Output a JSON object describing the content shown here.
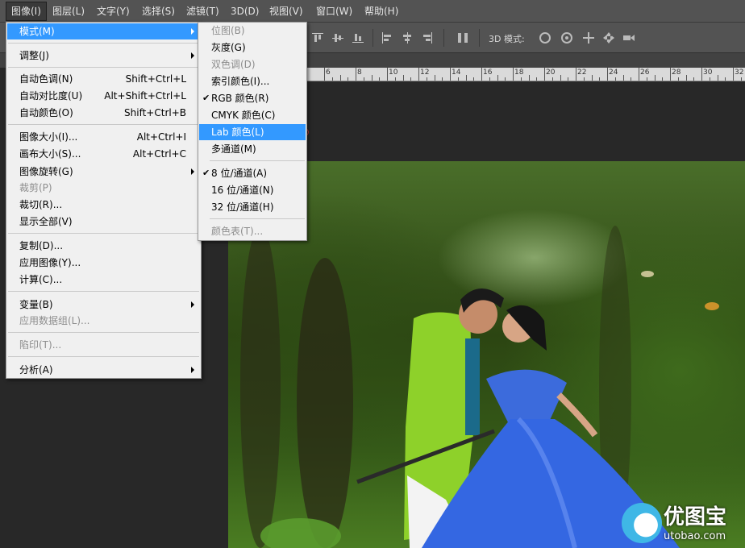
{
  "menubar": [
    {
      "label": "图像(I)",
      "active": true
    },
    {
      "label": "图层(L)"
    },
    {
      "label": "文字(Y)"
    },
    {
      "label": "选择(S)"
    },
    {
      "label": "滤镜(T)"
    },
    {
      "label": "3D(D)"
    },
    {
      "label": "视图(V)"
    },
    {
      "label": "窗口(W)"
    },
    {
      "label": "帮助(H)"
    }
  ],
  "options_bar": {
    "mode_3d_label": "3D 模式:",
    "icons": [
      "align-top-icon",
      "align-vcenter-icon",
      "align-bottom-icon",
      "align-left-icon",
      "align-hcenter-icon",
      "align-right-icon",
      "distribute-icon",
      "orbit-3d-icon",
      "roll-3d-icon",
      "pan-3d-icon",
      "slide-3d-icon",
      "scale-3d-icon"
    ]
  },
  "ruler": {
    "labels": [
      "6",
      "8",
      "10",
      "12",
      "14",
      "16",
      "18",
      "20",
      "22",
      "24",
      "26",
      "28",
      "30",
      "32"
    ]
  },
  "image_menu": {
    "items": [
      {
        "label": "模式(M)",
        "submenu": true,
        "highlighted": true
      },
      {
        "label": "调整(J)",
        "submenu": true
      },
      {
        "label": "自动色调(N)",
        "shortcut": "Shift+Ctrl+L"
      },
      {
        "label": "自动对比度(U)",
        "shortcut": "Alt+Shift+Ctrl+L"
      },
      {
        "label": "自动颜色(O)",
        "shortcut": "Shift+Ctrl+B"
      },
      {
        "label": "图像大小(I)...",
        "shortcut": "Alt+Ctrl+I"
      },
      {
        "label": "画布大小(S)...",
        "shortcut": "Alt+Ctrl+C"
      },
      {
        "label": "图像旋转(G)",
        "submenu": true
      },
      {
        "label": "裁剪(P)",
        "disabled": true
      },
      {
        "label": "裁切(R)..."
      },
      {
        "label": "显示全部(V)"
      },
      {
        "label": "复制(D)..."
      },
      {
        "label": "应用图像(Y)..."
      },
      {
        "label": "计算(C)..."
      },
      {
        "label": "变量(B)",
        "submenu": true
      },
      {
        "label": "应用数据组(L)...",
        "disabled": true
      },
      {
        "label": "陷印(T)...",
        "disabled": true
      },
      {
        "label": "分析(A)",
        "submenu": true
      }
    ]
  },
  "mode_submenu": {
    "items": [
      {
        "label": "位图(B)",
        "disabled": true
      },
      {
        "label": "灰度(G)"
      },
      {
        "label": "双色调(D)",
        "disabled": true
      },
      {
        "label": "索引颜色(I)..."
      },
      {
        "label": "RGB 颜色(R)",
        "checked": true
      },
      {
        "label": "CMYK 颜色(C)"
      },
      {
        "label": "Lab 颜色(L)",
        "highlighted": true
      },
      {
        "label": "多通道(M)"
      },
      {
        "label": "8 位/通道(A)",
        "checked": true
      },
      {
        "label": "16 位/通道(N)"
      },
      {
        "label": "32 位/通道(H)"
      },
      {
        "label": "颜色表(T)...",
        "disabled": true
      }
    ]
  },
  "watermark": {
    "title": "优图宝",
    "url": "utobao.com"
  },
  "colors": {
    "menu_highlight": "#3399ff",
    "annotation_circle": "#d23a3a",
    "ui_dark": "#535353"
  }
}
